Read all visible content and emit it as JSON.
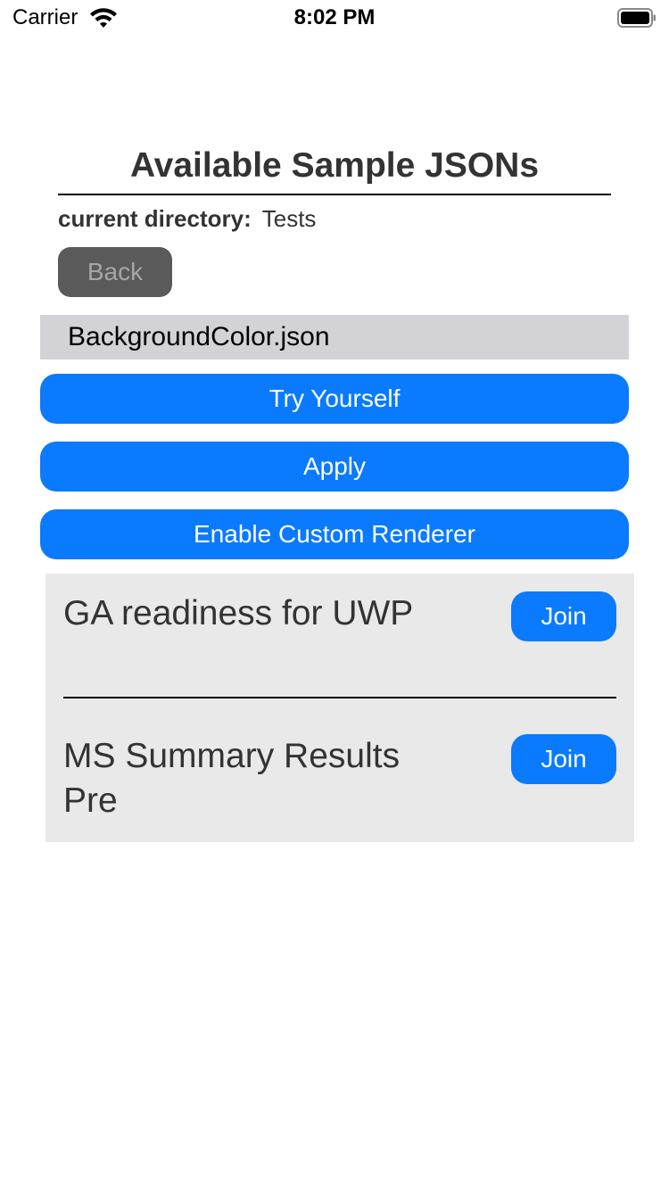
{
  "status_bar": {
    "carrier": "Carrier",
    "time": "8:02 PM",
    "wifi_icon": "wifi-icon",
    "battery_icon": "battery-icon"
  },
  "header": {
    "title": "Available Sample JSONs",
    "directory_label": "current directory:",
    "directory_value": "Tests",
    "back_label": "Back"
  },
  "file": {
    "name": "BackgroundColor.json"
  },
  "actions": {
    "try_yourself": "Try Yourself",
    "apply": "Apply",
    "enable_custom_renderer": "Enable Custom Renderer"
  },
  "card": {
    "items": [
      {
        "title": "GA readiness for UWP",
        "join_label": "Join"
      },
      {
        "title": "MS Summary Results Pre",
        "join_label": "Join"
      }
    ]
  },
  "colors": {
    "accent_blue": "#0a7aff",
    "back_button": "#5a5a5a",
    "file_row": "#d2d2d7",
    "card_background": "#e9e9e9"
  }
}
